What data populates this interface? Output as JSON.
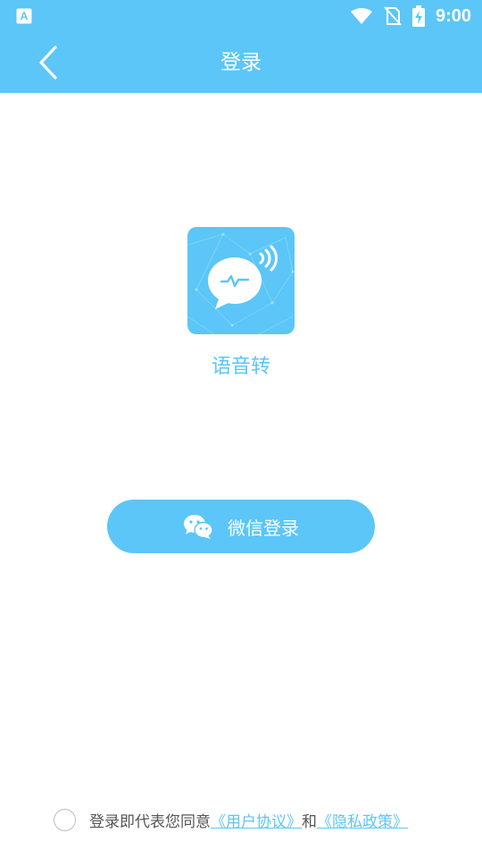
{
  "status_bar": {
    "time": "9:00",
    "icons": [
      "app-notification-icon",
      "wifi-icon",
      "no-sim-icon",
      "battery-charging-icon"
    ]
  },
  "app_bar": {
    "title": "登录",
    "back_icon": "chevron-left-icon"
  },
  "app": {
    "name": "语音转",
    "logo_icon": "speech-bubble-waveform-icon"
  },
  "login": {
    "wechat_label": "微信登录",
    "wechat_icon": "wechat-icon"
  },
  "agreement": {
    "prefix": "登录即代表您同意",
    "user_agreement": "《用户协议》",
    "conjunction": "和",
    "privacy_policy": "《隐私政策》",
    "checked": false
  },
  "colors": {
    "primary": "#5bc6f7",
    "background": "#ffffff",
    "text_gray": "#555555"
  }
}
